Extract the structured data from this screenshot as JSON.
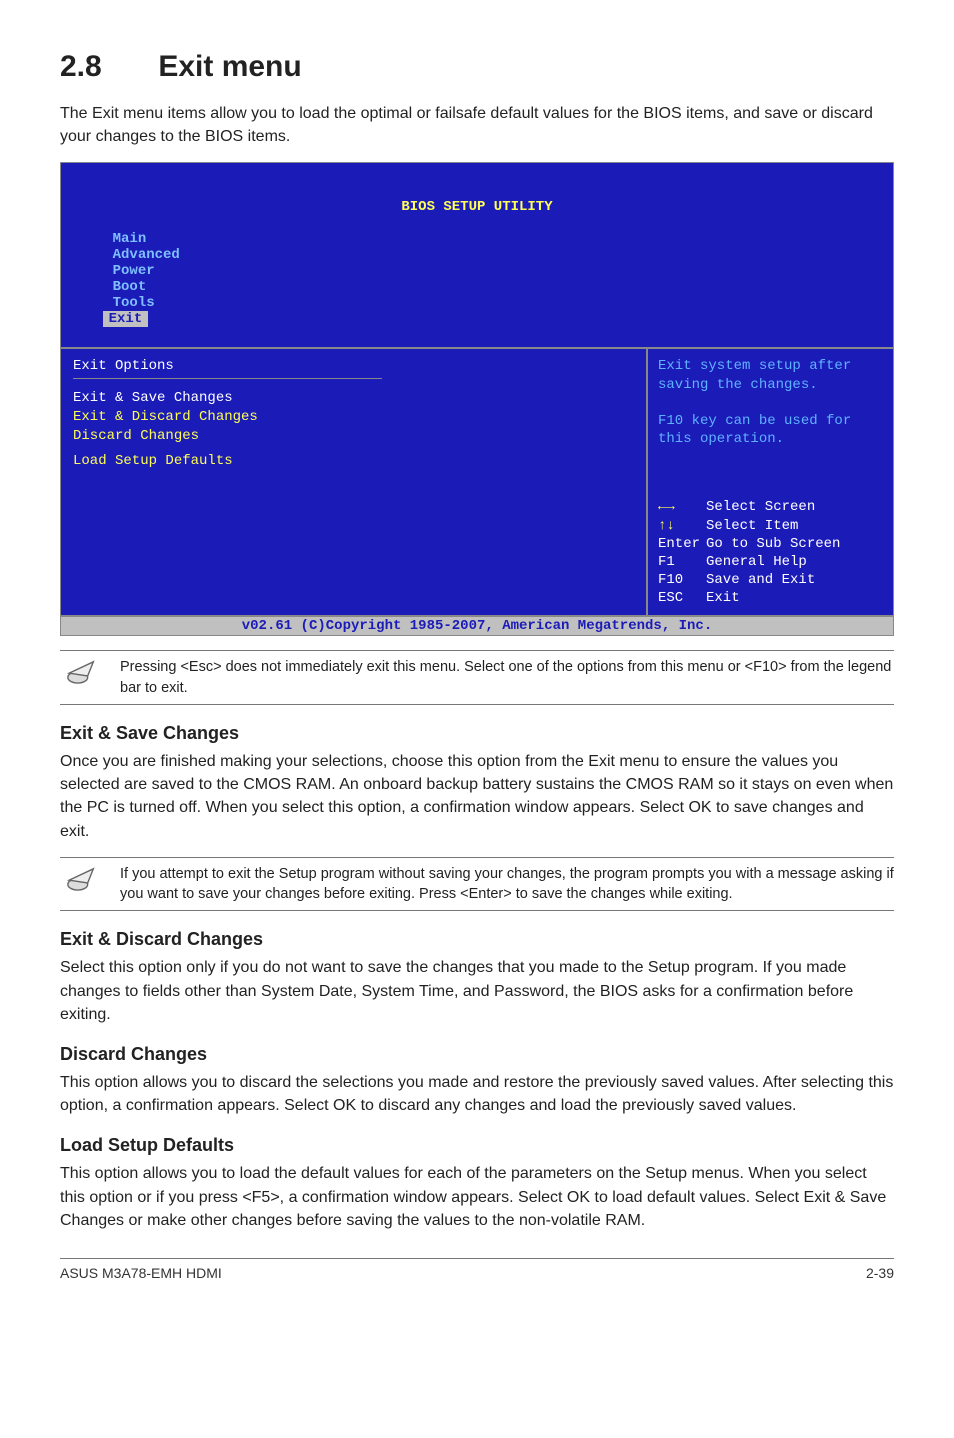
{
  "heading": {
    "num": "2.8",
    "title": "Exit menu"
  },
  "intro": "The Exit menu items allow you to load the optimal or failsafe default values for the BIOS items, and save or discard your changes to the BIOS items.",
  "bios": {
    "utility_title": "BIOS SETUP UTILITY",
    "tabs": [
      "Main",
      "Advanced",
      "Power",
      "Boot",
      "Tools",
      "Exit"
    ],
    "active_tab": "Exit",
    "left_header": "Exit Options",
    "items": [
      "Exit & Save Changes",
      "Exit & Discard Changes",
      "Discard Changes",
      "Load Setup Defaults"
    ],
    "help": "Exit system setup after saving the changes.\n\nF10 key can be used for this operation.",
    "keys": [
      {
        "k": "←→",
        "label": "Select Screen"
      },
      {
        "k": "↑↓",
        "label": "Select Item"
      },
      {
        "k": "Enter",
        "label": "Go to Sub Screen"
      },
      {
        "k": "F1",
        "label": "General Help"
      },
      {
        "k": "F10",
        "label": "Save and Exit"
      },
      {
        "k": "ESC",
        "label": "Exit"
      }
    ],
    "footer": "v02.61 (C)Copyright 1985-2007, American Megatrends, Inc."
  },
  "note1": "Pressing <Esc> does not immediately exit this menu. Select one of the options from this menu or <F10> from the legend bar to exit.",
  "sections": {
    "s1": {
      "title": "Exit & Save Changes",
      "body": "Once you are finished making your selections, choose this option from the Exit menu to ensure the values you selected are saved to the CMOS RAM. An onboard backup battery sustains the CMOS RAM so it stays on even when the PC is turned off. When you select this option, a confirmation window appears. Select OK to save changes and exit."
    },
    "s2": {
      "title": "Exit & Discard Changes",
      "body": "Select this option only if you do not want to save the changes that you  made to the Setup program. If you made changes to fields other than System Date, System Time, and Password, the BIOS asks for a confirmation before exiting."
    },
    "s3": {
      "title": "Discard Changes",
      "body": "This option allows you to discard the selections you made and restore the previously saved values. After selecting this option, a confirmation appears. Select OK to discard any changes and load the previously saved values."
    },
    "s4": {
      "title": "Load Setup Defaults",
      "body": "This option allows you to load the default values for each of the parameters on the Setup menus. When you select this option or if you press <F5>, a confirmation window appears. Select OK to load default values. Select Exit & Save Changes or make other changes before saving the values to the non-volatile RAM."
    }
  },
  "note2": " If you attempt to exit the Setup program without saving your changes, the program prompts you with a message asking if you want to save your changes before exiting. Press <Enter>  to save the  changes while exiting.",
  "footer": {
    "left": "ASUS M3A78-EMH HDMI",
    "right": "2-39"
  }
}
